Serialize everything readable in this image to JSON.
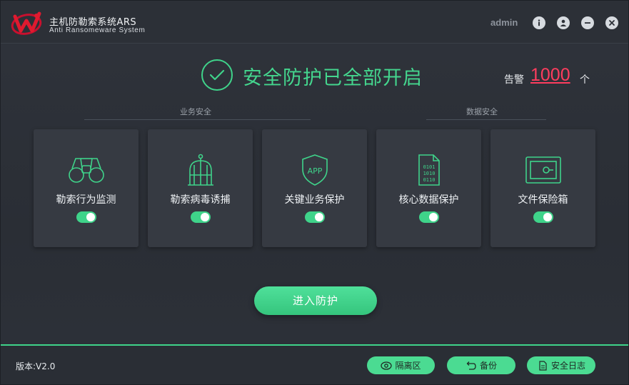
{
  "app": {
    "title": "主机防勒索系统ARS",
    "subtitle": "Anti Ransomeware System",
    "user": "admin"
  },
  "status": {
    "text": "安全防护已全部开启",
    "alarm_label": "告警",
    "alarm_count": "1000",
    "alarm_unit": "个"
  },
  "sections": {
    "business": "业务安全",
    "data": "数据安全"
  },
  "cards": [
    {
      "label": "勒索行为监测",
      "icon": "binoculars-icon",
      "enabled": true
    },
    {
      "label": "勒索病毒诱捕",
      "icon": "birdcage-icon",
      "enabled": true
    },
    {
      "label": "关键业务保护",
      "icon": "app-shield-icon",
      "enabled": true
    },
    {
      "label": "核心数据保护",
      "icon": "binary-file-icon",
      "enabled": true
    },
    {
      "label": "文件保险箱",
      "icon": "safe-box-icon",
      "enabled": true
    }
  ],
  "actions": {
    "enter": "进入防护"
  },
  "footer": {
    "version": "版本:V2.0",
    "quarantine": "隔离区",
    "backup": "备份",
    "security_log": "安全日志"
  },
  "colors": {
    "accent": "#3fd38a",
    "alarm": "#ff3d5e",
    "background": "#2b2f37",
    "card": "#363a42"
  }
}
